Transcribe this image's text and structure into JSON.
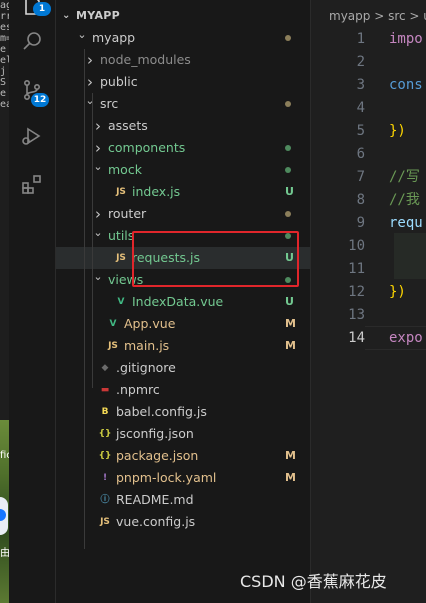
{
  "desktop_text": "ag\nrr\nes\nm=\ne\nel\nj\nS\ne\nea",
  "desktop_text2": "fic",
  "desktop_text3": "由",
  "activity": {
    "explorer_badge": "1",
    "scm_badge": "12"
  },
  "explorer": {
    "title": "MYAPP",
    "rows": [
      {
        "name": "myapp",
        "kind": "folder-open",
        "indent": 0,
        "color": "#cccccc",
        "status": "dot",
        "status_color": "#8b7e5a"
      },
      {
        "name": "node_modules",
        "kind": "folder",
        "indent": 1,
        "color": "#8c8c8c",
        "status": "",
        "status_color": ""
      },
      {
        "name": "public",
        "kind": "folder",
        "indent": 1,
        "color": "#cccccc",
        "status": "",
        "status_color": ""
      },
      {
        "name": "src",
        "kind": "folder-open",
        "indent": 1,
        "color": "#cccccc",
        "status": "dot",
        "status_color": "#8b7e5a"
      },
      {
        "name": "assets",
        "kind": "folder",
        "indent": 2,
        "color": "#cccccc",
        "status": "",
        "status_color": ""
      },
      {
        "name": "components",
        "kind": "folder",
        "indent": 2,
        "color": "#73c991",
        "status": "dot",
        "status_color": "#4e8a5e"
      },
      {
        "name": "mock",
        "kind": "folder-open",
        "indent": 2,
        "color": "#73c991",
        "status": "dot",
        "status_color": "#4e8a5e"
      },
      {
        "name": "index.js",
        "kind": "js",
        "indent": 3,
        "color": "#73c991",
        "status": "U",
        "status_color": "#73c991"
      },
      {
        "name": "router",
        "kind": "folder",
        "indent": 2,
        "color": "#cccccc",
        "status": "dot",
        "status_color": "#8b7e5a"
      },
      {
        "name": "utils",
        "kind": "folder-open",
        "indent": 2,
        "color": "#73c991",
        "status": "dot",
        "status_color": "#4e8a5e"
      },
      {
        "name": "requests.js",
        "kind": "js",
        "indent": 3,
        "color": "#73c991",
        "status": "U",
        "status_color": "#73c991"
      },
      {
        "name": "views",
        "kind": "folder-open",
        "indent": 2,
        "color": "#73c991",
        "status": "dot",
        "status_color": "#4e8a5e"
      },
      {
        "name": "IndexData.vue",
        "kind": "vue",
        "indent": 3,
        "color": "#73c991",
        "status": "U",
        "status_color": "#73c991"
      },
      {
        "name": "App.vue",
        "kind": "vue",
        "indent": 2,
        "color": "#e2c08d",
        "status": "M",
        "status_color": "#e2c08d"
      },
      {
        "name": "main.js",
        "kind": "js",
        "indent": 2,
        "color": "#e2c08d",
        "status": "M",
        "status_color": "#e2c08d"
      },
      {
        "name": ".gitignore",
        "kind": "git",
        "indent": 1,
        "color": "#cccccc",
        "status": "",
        "status_color": ""
      },
      {
        "name": ".npmrc",
        "kind": "npm",
        "indent": 1,
        "color": "#cccccc",
        "status": "",
        "status_color": ""
      },
      {
        "name": "babel.config.js",
        "kind": "babel",
        "indent": 1,
        "color": "#cccccc",
        "status": "",
        "status_color": ""
      },
      {
        "name": "jsconfig.json",
        "kind": "json",
        "indent": 1,
        "color": "#cccccc",
        "status": "",
        "status_color": ""
      },
      {
        "name": "package.json",
        "kind": "json",
        "indent": 1,
        "color": "#e2c08d",
        "status": "M",
        "status_color": "#e2c08d"
      },
      {
        "name": "pnpm-lock.yaml",
        "kind": "yaml",
        "indent": 1,
        "color": "#e2c08d",
        "status": "M",
        "status_color": "#e2c08d"
      },
      {
        "name": "README.md",
        "kind": "info",
        "indent": 1,
        "color": "#cccccc",
        "status": "",
        "status_color": ""
      },
      {
        "name": "vue.config.js",
        "kind": "js",
        "indent": 1,
        "color": "#cccccc",
        "status": "",
        "status_color": ""
      }
    ]
  },
  "editor": {
    "breadcrumb": "myapp > src > ut",
    "lines": [
      {
        "n": "1",
        "text": "impo",
        "color": "#c586c0"
      },
      {
        "n": "2",
        "text": "",
        "color": "#cccccc"
      },
      {
        "n": "3",
        "text": "cons",
        "color": "#569cd6"
      },
      {
        "n": "4",
        "text": "",
        "color": "#cccccc"
      },
      {
        "n": "5",
        "text": "})",
        "color": "#ffd700"
      },
      {
        "n": "6",
        "text": "",
        "color": "#cccccc"
      },
      {
        "n": "7",
        "text": "//写",
        "color": "#6a9955"
      },
      {
        "n": "8",
        "text": "//我",
        "color": "#6a9955"
      },
      {
        "n": "9",
        "text": "requ",
        "color": "#9cdcfe"
      },
      {
        "n": "10",
        "text": "",
        "color": "#cccccc"
      },
      {
        "n": "11",
        "text": "",
        "color": "#cccccc"
      },
      {
        "n": "12",
        "text": "})",
        "color": "#ffd700"
      },
      {
        "n": "13",
        "text": "",
        "color": "#cccccc"
      },
      {
        "n": "14",
        "text": "expo",
        "color": "#c586c0"
      }
    ]
  },
  "watermark": "CSDN @香蕉麻花皮",
  "colors": {
    "highlight_border": "#e0262b",
    "accent": "#0078d4"
  }
}
